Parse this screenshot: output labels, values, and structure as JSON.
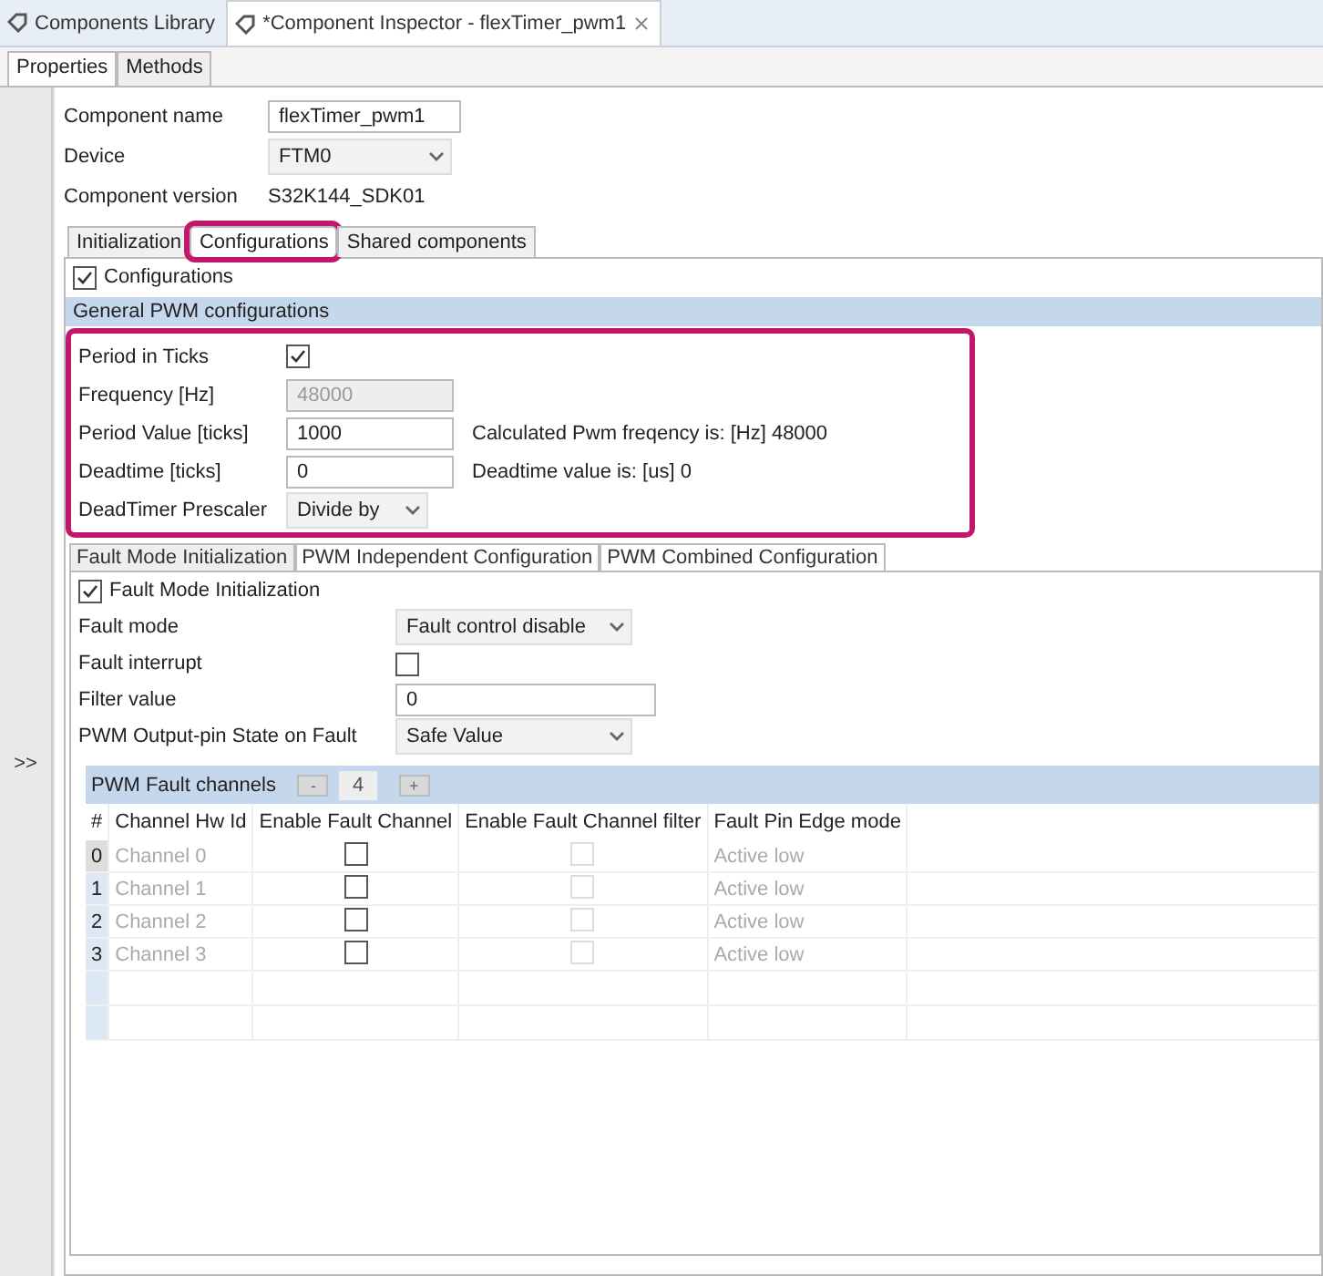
{
  "editor_tabs": [
    {
      "label": "Components Library",
      "selected": false
    },
    {
      "label": "*Component Inspector - flexTimer_pwm1",
      "selected": true
    }
  ],
  "view_tabs": [
    {
      "label": "Properties",
      "selected": true
    },
    {
      "label": "Methods",
      "selected": false
    }
  ],
  "collapse_button": ">>",
  "fields": [
    {
      "label": "Component name",
      "kind": "input",
      "value": "flexTimer_pwm1"
    },
    {
      "label": "Device",
      "kind": "select",
      "value": "FTM0"
    },
    {
      "label": "Component version",
      "kind": "text",
      "value": "S32K144_SDK01"
    }
  ],
  "config_tabs": [
    {
      "label": "Initialization",
      "selected": false,
      "highlighted": false
    },
    {
      "label": "Configurations",
      "selected": true,
      "highlighted": true
    },
    {
      "label": "Shared components",
      "selected": false,
      "highlighted": false
    }
  ],
  "configurations_checkbox": {
    "label": "Configurations",
    "checked": true
  },
  "general_section": {
    "title": "General PWM configurations",
    "highlighted": true,
    "rows": [
      {
        "label": "Period in Ticks",
        "kind": "checkbox",
        "checked": true
      },
      {
        "label": "Frequency [Hz]",
        "kind": "input",
        "value": "48000",
        "disabled": true
      },
      {
        "label": "Period Value [ticks]",
        "kind": "input",
        "value": "1000",
        "disabled": false,
        "note": "Calculated Pwm freqency is: [Hz] 48000"
      },
      {
        "label": "Deadtime [ticks]",
        "kind": "input",
        "value": "0",
        "disabled": false,
        "note": "Deadtime value is: [us] 0"
      },
      {
        "label": "DeadTimer Prescaler",
        "kind": "select",
        "value": "Divide by"
      }
    ]
  },
  "fault_tabs": [
    {
      "label": "Fault Mode Initialization",
      "selected": true
    },
    {
      "label": "PWM Independent Configuration",
      "selected": false
    },
    {
      "label": "PWM Combined Configuration",
      "selected": false
    }
  ],
  "fault_checkbox": {
    "label": "Fault Mode Initialization",
    "checked": true
  },
  "fault_rows": [
    {
      "label": "Fault mode",
      "kind": "select",
      "value": "Fault control disable"
    },
    {
      "label": "Fault interrupt",
      "kind": "checkbox",
      "checked": false
    },
    {
      "label": "Filter value",
      "kind": "input",
      "value": "0",
      "disabled": false
    },
    {
      "label": "PWM Output-pin State on Fault",
      "kind": "select",
      "value": "Safe Value"
    }
  ],
  "fault_channels": {
    "title": "PWM Fault channels",
    "decrement": "-",
    "count": "4",
    "increment": "+",
    "columns": [
      "#",
      "Channel Hw Id",
      "Enable Fault Channel",
      "Enable Fault Channel filter",
      "Fault Pin Edge mode"
    ],
    "rows": [
      {
        "index": "0",
        "channel": "Channel 0",
        "enable": false,
        "filter": false,
        "filter_disabled": true,
        "edge_mode": "Active low",
        "selected": true
      },
      {
        "index": "1",
        "channel": "Channel 1",
        "enable": false,
        "filter": false,
        "filter_disabled": true,
        "edge_mode": "Active low",
        "selected": false
      },
      {
        "index": "2",
        "channel": "Channel 2",
        "enable": false,
        "filter": false,
        "filter_disabled": true,
        "edge_mode": "Active low",
        "selected": false
      },
      {
        "index": "3",
        "channel": "Channel 3",
        "enable": false,
        "filter": false,
        "filter_disabled": true,
        "edge_mode": "Active low",
        "selected": false
      }
    ]
  }
}
